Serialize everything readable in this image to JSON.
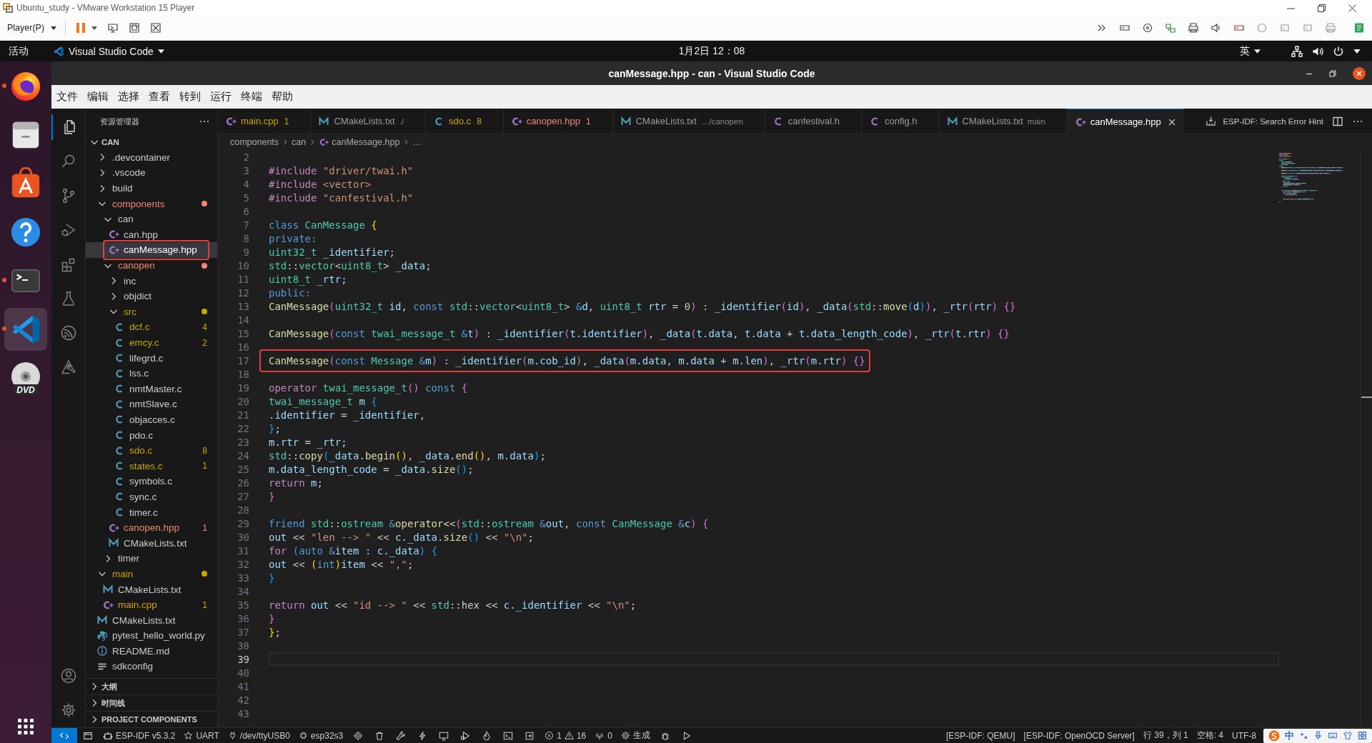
{
  "vmware": {
    "title": "Ubuntu_study - VMware Workstation 15 Player",
    "player_menu": "Player(P)"
  },
  "top_bar": {
    "activities": "活动",
    "app_menu": "Visual Studio Code",
    "clock": "1月2日  12：08",
    "input_method": "英"
  },
  "dock": [
    {
      "kind": "browser",
      "running": true,
      "selected": false
    },
    {
      "kind": "files",
      "running": false,
      "selected": false
    },
    {
      "kind": "store",
      "running": false,
      "selected": false
    },
    {
      "kind": "help",
      "running": false,
      "selected": false
    },
    {
      "kind": "terminal",
      "running": true,
      "selected": false
    },
    {
      "kind": "editor",
      "running": true,
      "selected": true
    },
    {
      "kind": "disc",
      "label": "DVD",
      "running": false,
      "selected": false
    }
  ],
  "vscode": {
    "title": "canMessage.hpp - can - Visual Studio Code",
    "menu": [
      "文件",
      "编辑",
      "选择",
      "查看",
      "转到",
      "运行",
      "终端",
      "帮助"
    ],
    "activity_bar": [
      {
        "kind": "explorer",
        "selected": true
      },
      {
        "kind": "search",
        "selected": false
      },
      {
        "kind": "source-control",
        "selected": false
      },
      {
        "kind": "run-debug",
        "selected": false
      },
      {
        "kind": "extensions",
        "selected": false
      },
      {
        "kind": "testing",
        "selected": false
      },
      {
        "kind": "esp-idf",
        "selected": false
      },
      {
        "kind": "tool",
        "selected": false
      }
    ],
    "sidebar": {
      "title": "资源管理器",
      "workspace": {
        "label": "CAN",
        "expanded": true
      },
      "tree": [
        {
          "label": ".devcontainer",
          "kind": "folder",
          "expanded": false,
          "selected": false,
          "boxed": false
        },
        {
          "label": ".vscode",
          "kind": "folder",
          "expanded": false,
          "selected": false,
          "boxed": false
        },
        {
          "label": "build",
          "kind": "folder",
          "expanded": false,
          "selected": false,
          "boxed": false
        },
        {
          "label": "components",
          "kind": "folder",
          "expanded": true,
          "color": "#f48771",
          "selected": false,
          "boxed": false,
          "children": [
            {
              "label": "can",
              "kind": "folder",
              "expanded": true,
              "selected": false,
              "boxed": false,
              "children": [
                {
                  "label": "can.hpp",
                  "kind": "cpp",
                  "selected": false,
                  "boxed": false
                },
                {
                  "label": "canMessage.hpp",
                  "kind": "cpp",
                  "selected": true,
                  "boxed": true
                }
              ]
            },
            {
              "label": "canopen",
              "kind": "folder",
              "expanded": true,
              "color": "#f48771",
              "selected": false,
              "boxed": false,
              "children": [
                {
                  "label": "inc",
                  "kind": "folder",
                  "expanded": false,
                  "selected": false,
                  "boxed": false
                },
                {
                  "label": "objdict",
                  "kind": "folder",
                  "expanded": false,
                  "selected": false,
                  "boxed": false
                },
                {
                  "label": "src",
                  "kind": "folder",
                  "expanded": true,
                  "color": "#cca700",
                  "selected": false,
                  "boxed": false,
                  "children": [
                    {
                      "label": "dcf.c",
                      "kind": "c",
                      "color": "#cca700",
                      "badge": "4",
                      "selected": false,
                      "boxed": false
                    },
                    {
                      "label": "emcy.c",
                      "kind": "c",
                      "color": "#cca700",
                      "badge": "2",
                      "selected": false,
                      "boxed": false
                    },
                    {
                      "label": "lifegrd.c",
                      "kind": "c",
                      "selected": false,
                      "boxed": false
                    },
                    {
                      "label": "lss.c",
                      "kind": "c",
                      "selected": false,
                      "boxed": false
                    },
                    {
                      "label": "nmtMaster.c",
                      "kind": "c",
                      "selected": false,
                      "boxed": false
                    },
                    {
                      "label": "nmtSlave.c",
                      "kind": "c",
                      "selected": false,
                      "boxed": false
                    },
                    {
                      "label": "objacces.c",
                      "kind": "c",
                      "selected": false,
                      "boxed": false
                    },
                    {
                      "label": "pdo.c",
                      "kind": "c",
                      "selected": false,
                      "boxed": false
                    },
                    {
                      "label": "sdo.c",
                      "kind": "c",
                      "color": "#cca700",
                      "badge": "8",
                      "selected": false,
                      "boxed": false
                    },
                    {
                      "label": "states.c",
                      "kind": "c",
                      "color": "#cca700",
                      "badge": "1",
                      "selected": false,
                      "boxed": false
                    },
                    {
                      "label": "symbols.c",
                      "kind": "c",
                      "selected": false,
                      "boxed": false
                    },
                    {
                      "label": "sync.c",
                      "kind": "c",
                      "selected": false,
                      "boxed": false
                    },
                    {
                      "label": "timer.c",
                      "kind": "c",
                      "selected": false,
                      "boxed": false
                    }
                  ]
                },
                {
                  "label": "canopen.hpp",
                  "kind": "cpp",
                  "color": "#f48771",
                  "badge": "1",
                  "selected": false,
                  "boxed": false
                },
                {
                  "label": "CMakeLists.txt",
                  "kind": "cmake",
                  "selected": false,
                  "boxed": false
                }
              ]
            },
            {
              "label": "timer",
              "kind": "folder",
              "expanded": false,
              "selected": false,
              "boxed": false
            }
          ]
        },
        {
          "label": "main",
          "kind": "folder",
          "expanded": true,
          "color": "#cca700",
          "selected": false,
          "boxed": false,
          "children": [
            {
              "label": "CMakeLists.txt",
              "kind": "cmake",
              "selected": false,
              "boxed": false
            },
            {
              "label": "main.cpp",
              "kind": "cpp",
              "color": "#cca700",
              "badge": "1",
              "selected": false,
              "boxed": false
            }
          ]
        },
        {
          "label": "CMakeLists.txt",
          "kind": "cmake",
          "selected": false,
          "boxed": false
        },
        {
          "label": "pytest_hello_world.py",
          "kind": "python",
          "selected": false,
          "boxed": false
        },
        {
          "label": "README.md",
          "kind": "info",
          "selected": false,
          "boxed": false
        },
        {
          "label": "sdkconfig",
          "kind": "config",
          "selected": false,
          "boxed": false
        }
      ],
      "sections": [
        {
          "label": "大纲",
          "expanded": false
        },
        {
          "label": "时间线",
          "expanded": false
        },
        {
          "label": "PROJECT COMPONENTS",
          "expanded": false
        }
      ]
    },
    "tabs": [
      {
        "label": "main.cpp",
        "kind": "cpp",
        "color": "#cca700",
        "badge": "1",
        "selected": false
      },
      {
        "label": "CMakeLists.txt",
        "kind": "cmake",
        "description": "./",
        "selected": false
      },
      {
        "label": "sdo.c",
        "kind": "c",
        "color": "#cca700",
        "badge": "8",
        "selected": false
      },
      {
        "label": "canopen.hpp",
        "kind": "cpp",
        "color": "#f48771",
        "badge": "1",
        "selected": false
      },
      {
        "label": "CMakeLists.txt",
        "kind": "cmake",
        "description": "…/canopen",
        "selected": false
      },
      {
        "label": "canfestival.h",
        "kind": "h",
        "selected": false
      },
      {
        "label": "config.h",
        "kind": "h",
        "selected": false
      },
      {
        "label": "CMakeLists.txt",
        "kind": "cmake",
        "description": "main",
        "selected": false
      },
      {
        "label": "canMessage.hpp",
        "kind": "cpp",
        "selected": true
      }
    ],
    "editor_actions": {
      "error_hint": "ESP-IDF: Search Error Hint"
    },
    "breadcrumbs": [
      {
        "label": "components",
        "kind": "folder"
      },
      {
        "label": "can",
        "kind": "folder"
      },
      {
        "label": "canMessage.hpp",
        "kind": "cpp"
      },
      {
        "label": "…",
        "kind": "more"
      }
    ],
    "code": {
      "lines": [
        {
          "number": "2",
          "current": false,
          "boxed": false
        },
        {
          "number": "3",
          "current": false,
          "boxed": false,
          "tokens": [
            {
              "text": "#include",
              "kind": "keyword"
            },
            {
              "text": " \"driver/twai.h\"",
              "kind": "string"
            }
          ]
        },
        {
          "number": "4",
          "current": false,
          "boxed": false,
          "tokens": [
            {
              "text": "#include",
              "kind": "keyword"
            },
            {
              "text": " <vector>",
              "kind": "string"
            }
          ]
        },
        {
          "number": "5",
          "current": false,
          "boxed": false,
          "tokens": [
            {
              "text": "#include",
              "kind": "keyword"
            },
            {
              "text": " \"canfestival.h\"",
              "kind": "string"
            }
          ]
        },
        {
          "number": "6",
          "current": false,
          "boxed": false
        },
        {
          "number": "7",
          "current": false,
          "boxed": false,
          "tokens": [
            {
              "text": "class",
              "kind": "storage"
            },
            {
              "text": " CanMessage",
              "kind": "type"
            },
            {
              "text": " {",
              "kind": "bracket1"
            }
          ]
        },
        {
          "number": "8",
          "current": false,
          "boxed": false,
          "tokens": [
            {
              "text": "private:",
              "kind": "storage"
            }
          ]
        },
        {
          "number": "9",
          "current": false,
          "boxed": false,
          "tokens": [
            {
              "text": "    uint32_t",
              "kind": "type"
            },
            {
              "text": " _identifier",
              "kind": "variable"
            },
            {
              "text": ";",
              "kind": "plain"
            }
          ]
        },
        {
          "number": "10",
          "current": false,
          "boxed": false,
          "tokens": [
            {
              "text": "    std",
              "kind": "type"
            },
            {
              "text": "::",
              "kind": "plain"
            },
            {
              "text": "vector",
              "kind": "type"
            },
            {
              "text": "<",
              "kind": "plain"
            },
            {
              "text": "uint8_t",
              "kind": "type"
            },
            {
              "text": "> ",
              "kind": "plain"
            },
            {
              "text": "_data",
              "kind": "variable"
            },
            {
              "text": ";",
              "kind": "plain"
            }
          ]
        },
        {
          "number": "11",
          "current": false,
          "boxed": false,
          "tokens": [
            {
              "text": "    uint8_t",
              "kind": "type"
            },
            {
              "text": " _rtr",
              "kind": "variable"
            },
            {
              "text": ";",
              "kind": "plain"
            }
          ]
        },
        {
          "number": "12",
          "current": false,
          "boxed": false,
          "tokens": [
            {
              "text": "public:",
              "kind": "storage"
            }
          ]
        },
        {
          "number": "13",
          "current": false,
          "boxed": false,
          "tokens": [
            {
              "text": "    CanMessage",
              "kind": "function"
            },
            {
              "text": "(",
              "kind": "bracket2"
            },
            {
              "text": "uint32_t",
              "kind": "type"
            },
            {
              "text": " id",
              "kind": "variable"
            },
            {
              "text": ", ",
              "kind": "plain"
            },
            {
              "text": "const",
              "kind": "storage"
            },
            {
              "text": " std",
              "kind": "type"
            },
            {
              "text": "::",
              "kind": "plain"
            },
            {
              "text": "vector",
              "kind": "type"
            },
            {
              "text": "<",
              "kind": "plain"
            },
            {
              "text": "uint8_t",
              "kind": "type"
            },
            {
              "text": "> ",
              "kind": "plain"
            },
            {
              "text": "&",
              "kind": "storage"
            },
            {
              "text": "d",
              "kind": "variable"
            },
            {
              "text": ", ",
              "kind": "plain"
            },
            {
              "text": "uint8_t",
              "kind": "type"
            },
            {
              "text": " rtr",
              "kind": "variable"
            },
            {
              "text": " = ",
              "kind": "plain"
            },
            {
              "text": "0",
              "kind": "number"
            },
            {
              "text": ")",
              "kind": "bracket2"
            },
            {
              "text": " : ",
              "kind": "plain"
            },
            {
              "text": "_identifier",
              "kind": "variable"
            },
            {
              "text": "(",
              "kind": "bracket2"
            },
            {
              "text": "id",
              "kind": "variable"
            },
            {
              "text": ")",
              "kind": "bracket2"
            },
            {
              "text": ", ",
              "kind": "plain"
            },
            {
              "text": "_data",
              "kind": "variable"
            },
            {
              "text": "(",
              "kind": "bracket2"
            },
            {
              "text": "std",
              "kind": "type"
            },
            {
              "text": "::",
              "kind": "plain"
            },
            {
              "text": "move",
              "kind": "function"
            },
            {
              "text": "(",
              "kind": "bracket3"
            },
            {
              "text": "d",
              "kind": "variable"
            },
            {
              "text": ")",
              "kind": "bracket3"
            },
            {
              "text": ")",
              "kind": "bracket2"
            },
            {
              "text": ", ",
              "kind": "plain"
            },
            {
              "text": "_rtr",
              "kind": "variable"
            },
            {
              "text": "(",
              "kind": "bracket2"
            },
            {
              "text": "rtr",
              "kind": "variable"
            },
            {
              "text": ")",
              "kind": "bracket2"
            },
            {
              "text": " {}",
              "kind": "bracket2"
            }
          ]
        },
        {
          "number": "14",
          "current": false,
          "boxed": false
        },
        {
          "number": "15",
          "current": false,
          "boxed": false,
          "tokens": [
            {
              "text": "    CanMessage",
              "kind": "function"
            },
            {
              "text": "(",
              "kind": "bracket2"
            },
            {
              "text": "const",
              "kind": "storage"
            },
            {
              "text": " twai_message_t ",
              "kind": "type"
            },
            {
              "text": "&",
              "kind": "storage"
            },
            {
              "text": "t",
              "kind": "variable"
            },
            {
              "text": ")",
              "kind": "bracket2"
            },
            {
              "text": " : ",
              "kind": "plain"
            },
            {
              "text": "_identifier",
              "kind": "variable"
            },
            {
              "text": "(",
              "kind": "bracket2"
            },
            {
              "text": "t.identifier",
              "kind": "variable"
            },
            {
              "text": ")",
              "kind": "bracket2"
            },
            {
              "text": ", ",
              "kind": "plain"
            },
            {
              "text": "_data",
              "kind": "variable"
            },
            {
              "text": "(",
              "kind": "bracket2"
            },
            {
              "text": "t.data",
              "kind": "variable"
            },
            {
              "text": ", ",
              "kind": "plain"
            },
            {
              "text": "t.data",
              "kind": "variable"
            },
            {
              "text": " + ",
              "kind": "plain"
            },
            {
              "text": "t.data_length_code",
              "kind": "variable"
            },
            {
              "text": ")",
              "kind": "bracket2"
            },
            {
              "text": ", ",
              "kind": "plain"
            },
            {
              "text": "_rtr",
              "kind": "variable"
            },
            {
              "text": "(",
              "kind": "bracket2"
            },
            {
              "text": "t.rtr",
              "kind": "variable"
            },
            {
              "text": ")",
              "kind": "bracket2"
            },
            {
              "text": " {}",
              "kind": "bracket2"
            }
          ]
        },
        {
          "number": "16",
          "current": false,
          "boxed": false
        },
        {
          "number": "17",
          "current": false,
          "boxed": true,
          "tokens": [
            {
              "text": "    CanMessage",
              "kind": "function"
            },
            {
              "text": "(",
              "kind": "bracket2"
            },
            {
              "text": "const",
              "kind": "storage"
            },
            {
              "text": " Message ",
              "kind": "type"
            },
            {
              "text": "&",
              "kind": "storage"
            },
            {
              "text": "m",
              "kind": "variable"
            },
            {
              "text": ")",
              "kind": "bracket2"
            },
            {
              "text": " : ",
              "kind": "plain"
            },
            {
              "text": "_identifier",
              "kind": "variable"
            },
            {
              "text": "(",
              "kind": "bracket2"
            },
            {
              "text": "m.cob_id",
              "kind": "variable"
            },
            {
              "text": ")",
              "kind": "bracket2"
            },
            {
              "text": ", ",
              "kind": "plain"
            },
            {
              "text": "_data",
              "kind": "variable"
            },
            {
              "text": "(",
              "kind": "bracket2"
            },
            {
              "text": "m.data",
              "kind": "variable"
            },
            {
              "text": ", ",
              "kind": "plain"
            },
            {
              "text": "m.data",
              "kind": "variable"
            },
            {
              "text": " + ",
              "kind": "plain"
            },
            {
              "text": "m.len",
              "kind": "variable"
            },
            {
              "text": ")",
              "kind": "bracket2"
            },
            {
              "text": ", ",
              "kind": "plain"
            },
            {
              "text": "_rtr",
              "kind": "variable"
            },
            {
              "text": "(",
              "kind": "bracket2"
            },
            {
              "text": "m.rtr",
              "kind": "variable"
            },
            {
              "text": ")",
              "kind": "bracket2"
            },
            {
              "text": " {}",
              "kind": "bracket2"
            }
          ]
        },
        {
          "number": "18",
          "current": false,
          "boxed": false
        },
        {
          "number": "19",
          "current": false,
          "boxed": false,
          "tokens": [
            {
              "text": "    operator",
              "kind": "keyword"
            },
            {
              "text": " twai_message_t",
              "kind": "type"
            },
            {
              "text": "()",
              "kind": "bracket2"
            },
            {
              "text": " const",
              "kind": "storage"
            },
            {
              "text": " {",
              "kind": "bracket2"
            }
          ]
        },
        {
          "number": "20",
          "current": false,
          "boxed": false,
          "tokens": [
            {
              "text": "        twai_message_t",
              "kind": "type"
            },
            {
              "text": " m",
              "kind": "variable"
            },
            {
              "text": " {",
              "kind": "bracket3"
            }
          ]
        },
        {
          "number": "21",
          "current": false,
          "boxed": false,
          "tokens": [
            {
              "text": "            .identifier",
              "kind": "variable"
            },
            {
              "text": " = ",
              "kind": "plain"
            },
            {
              "text": "_identifier",
              "kind": "variable"
            },
            {
              "text": ",",
              "kind": "plain"
            }
          ]
        },
        {
          "number": "22",
          "current": false,
          "boxed": false,
          "tokens": [
            {
              "text": "        }",
              "kind": "bracket3"
            },
            {
              "text": ";",
              "kind": "plain"
            }
          ]
        },
        {
          "number": "23",
          "current": false,
          "boxed": false,
          "tokens": [
            {
              "text": "        m.rtr",
              "kind": "variable"
            },
            {
              "text": " = ",
              "kind": "plain"
            },
            {
              "text": "_rtr",
              "kind": "variable"
            },
            {
              "text": ";",
              "kind": "plain"
            }
          ]
        },
        {
          "number": "24",
          "current": false,
          "boxed": false,
          "tokens": [
            {
              "text": "        std",
              "kind": "type"
            },
            {
              "text": "::",
              "kind": "plain"
            },
            {
              "text": "copy",
              "kind": "function"
            },
            {
              "text": "(",
              "kind": "bracket3"
            },
            {
              "text": "_data",
              "kind": "variable"
            },
            {
              "text": ".",
              "kind": "plain"
            },
            {
              "text": "begin",
              "kind": "function"
            },
            {
              "text": "()",
              "kind": "bracket1"
            },
            {
              "text": ", ",
              "kind": "plain"
            },
            {
              "text": "_data",
              "kind": "variable"
            },
            {
              "text": ".",
              "kind": "plain"
            },
            {
              "text": "end",
              "kind": "function"
            },
            {
              "text": "()",
              "kind": "bracket1"
            },
            {
              "text": ", ",
              "kind": "plain"
            },
            {
              "text": "m.data",
              "kind": "variable"
            },
            {
              "text": ")",
              "kind": "bracket3"
            },
            {
              "text": ";",
              "kind": "plain"
            }
          ]
        },
        {
          "number": "25",
          "current": false,
          "boxed": false,
          "tokens": [
            {
              "text": "        m.data_length_code",
              "kind": "variable"
            },
            {
              "text": " = ",
              "kind": "plain"
            },
            {
              "text": "_data",
              "kind": "variable"
            },
            {
              "text": ".",
              "kind": "plain"
            },
            {
              "text": "size",
              "kind": "function"
            },
            {
              "text": "()",
              "kind": "bracket3"
            },
            {
              "text": ";",
              "kind": "plain"
            }
          ]
        },
        {
          "number": "26",
          "current": false,
          "boxed": false,
          "tokens": [
            {
              "text": "        return",
              "kind": "keyword"
            },
            {
              "text": " m",
              "kind": "variable"
            },
            {
              "text": ";",
              "kind": "plain"
            }
          ]
        },
        {
          "number": "27",
          "current": false,
          "boxed": false,
          "tokens": [
            {
              "text": "    }",
              "kind": "bracket2"
            }
          ]
        },
        {
          "number": "28",
          "current": false,
          "boxed": false
        },
        {
          "number": "29",
          "current": false,
          "boxed": false,
          "tokens": [
            {
              "text": "    friend",
              "kind": "storage"
            },
            {
              "text": " std",
              "kind": "type"
            },
            {
              "text": "::",
              "kind": "plain"
            },
            {
              "text": "ostream ",
              "kind": "type"
            },
            {
              "text": "&",
              "kind": "storage"
            },
            {
              "text": "operator<<",
              "kind": "function"
            },
            {
              "text": "(",
              "kind": "bracket2"
            },
            {
              "text": "std",
              "kind": "type"
            },
            {
              "text": "::",
              "kind": "plain"
            },
            {
              "text": "ostream ",
              "kind": "type"
            },
            {
              "text": "&",
              "kind": "storage"
            },
            {
              "text": "out",
              "kind": "variable"
            },
            {
              "text": ", ",
              "kind": "plain"
            },
            {
              "text": "const",
              "kind": "storage"
            },
            {
              "text": " CanMessage ",
              "kind": "type"
            },
            {
              "text": "&",
              "kind": "storage"
            },
            {
              "text": "c",
              "kind": "variable"
            },
            {
              "text": ")",
              "kind": "bracket2"
            },
            {
              "text": " {",
              "kind": "bracket2"
            }
          ]
        },
        {
          "number": "30",
          "current": false,
          "boxed": false,
          "tokens": [
            {
              "text": "        out",
              "kind": "variable"
            },
            {
              "text": " << ",
              "kind": "plain"
            },
            {
              "text": "\"len --> \"",
              "kind": "string"
            },
            {
              "text": " << ",
              "kind": "plain"
            },
            {
              "text": "c._data",
              "kind": "variable"
            },
            {
              "text": ".",
              "kind": "plain"
            },
            {
              "text": "size",
              "kind": "function"
            },
            {
              "text": "()",
              "kind": "bracket3"
            },
            {
              "text": " << ",
              "kind": "plain"
            },
            {
              "text": "\"\\n\"",
              "kind": "string"
            },
            {
              "text": ";",
              "kind": "plain"
            }
          ]
        },
        {
          "number": "31",
          "current": false,
          "boxed": false,
          "tokens": [
            {
              "text": "        for ",
              "kind": "keyword"
            },
            {
              "text": "(",
              "kind": "bracket3"
            },
            {
              "text": "auto &",
              "kind": "storage"
            },
            {
              "text": "item",
              "kind": "variable"
            },
            {
              "text": " : ",
              "kind": "plain"
            },
            {
              "text": "c._data",
              "kind": "variable"
            },
            {
              "text": ")",
              "kind": "bracket3"
            },
            {
              "text": " {",
              "kind": "bracket3"
            }
          ]
        },
        {
          "number": "32",
          "current": false,
          "boxed": false,
          "tokens": [
            {
              "text": "            out",
              "kind": "variable"
            },
            {
              "text": " << ",
              "kind": "plain"
            },
            {
              "text": "(",
              "kind": "bracket1"
            },
            {
              "text": "int",
              "kind": "storage"
            },
            {
              "text": ")",
              "kind": "bracket1"
            },
            {
              "text": "item",
              "kind": "variable"
            },
            {
              "text": " << ",
              "kind": "plain"
            },
            {
              "text": "\",\"",
              "kind": "string"
            },
            {
              "text": ";",
              "kind": "plain"
            }
          ]
        },
        {
          "number": "33",
          "current": false,
          "boxed": false,
          "tokens": [
            {
              "text": "        }",
              "kind": "bracket3"
            }
          ]
        },
        {
          "number": "34",
          "current": false,
          "boxed": false
        },
        {
          "number": "35",
          "current": false,
          "boxed": false,
          "tokens": [
            {
              "text": "        return",
              "kind": "keyword"
            },
            {
              "text": " out",
              "kind": "variable"
            },
            {
              "text": " << ",
              "kind": "plain"
            },
            {
              "text": "\"id --> \"",
              "kind": "string"
            },
            {
              "text": " << ",
              "kind": "plain"
            },
            {
              "text": "std",
              "kind": "type"
            },
            {
              "text": "::hex << ",
              "kind": "plain"
            },
            {
              "text": "c._identifier",
              "kind": "variable"
            },
            {
              "text": " << ",
              "kind": "plain"
            },
            {
              "text": "\"\\n\"",
              "kind": "string"
            },
            {
              "text": ";",
              "kind": "plain"
            }
          ]
        },
        {
          "number": "36",
          "current": false,
          "boxed": false,
          "tokens": [
            {
              "text": "    }",
              "kind": "bracket2"
            }
          ]
        },
        {
          "number": "37",
          "current": false,
          "boxed": false,
          "tokens": [
            {
              "text": "}",
              "kind": "bracket1"
            },
            {
              "text": ";",
              "kind": "plain"
            }
          ]
        },
        {
          "number": "38",
          "current": false,
          "boxed": false
        },
        {
          "number": "39",
          "current": true,
          "boxed": false
        },
        {
          "number": "40",
          "current": false,
          "boxed": false
        },
        {
          "number": "41",
          "current": false,
          "boxed": false
        },
        {
          "number": "42",
          "current": false,
          "boxed": false
        },
        {
          "number": "43",
          "current": false,
          "boxed": false
        }
      ]
    },
    "status_bar": {
      "idf_version": "ESP-IDF v5.3.2",
      "serial": "UART",
      "port": "/dev/ttyUSB0",
      "target": "esp32s3",
      "errors": "1",
      "warnings": "16",
      "ports": "0",
      "build": "生成",
      "qemu": "[ESP-IDF: QEMU]",
      "openocd": "[ESP-IDF: OpenOCD Server]",
      "cursor": "行 39，列 1",
      "indentation": "空格: 4",
      "encoding": "UTF-8",
      "ime_mode": "中"
    }
  }
}
